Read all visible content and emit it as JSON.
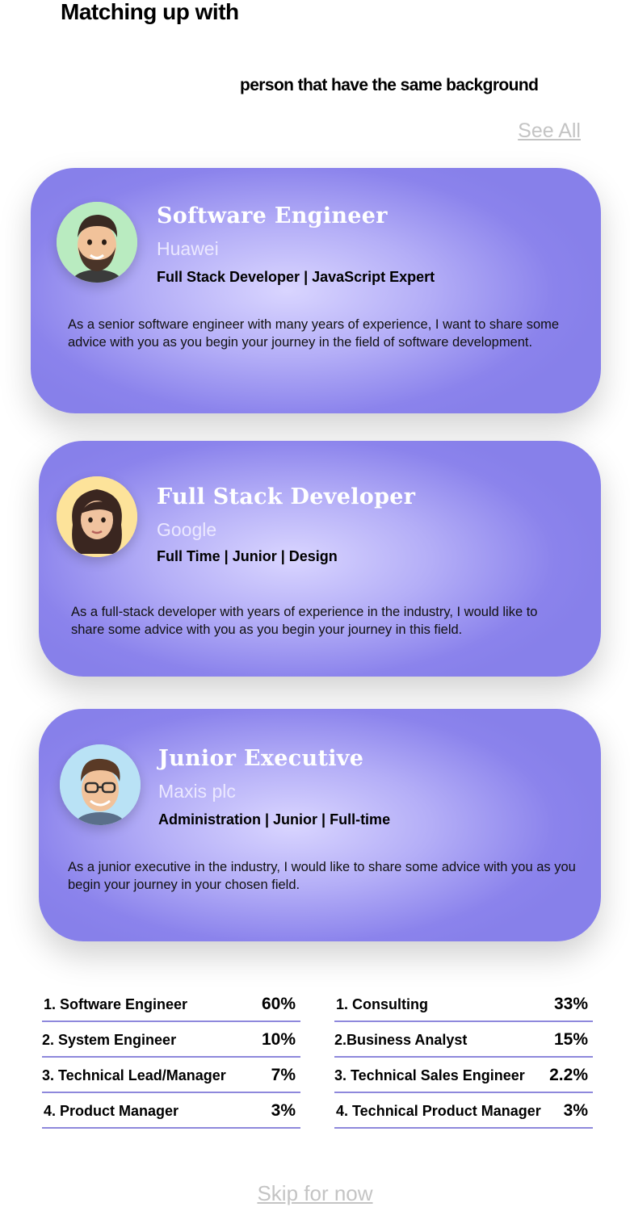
{
  "header": {
    "title": "Matching up with",
    "subtitle": "person that have the same background",
    "see_all": "See All"
  },
  "cards": [
    {
      "title": "Software Engineer",
      "company": "Huawei",
      "tags": "Full Stack Developer | JavaScript Expert",
      "description": "As a senior software engineer with many years of experience, I want to share some advice with you as you begin your journey in the field of software development.",
      "avatar_icon": "bearded-man-avatar-icon",
      "avatar_bg": "#b9ebc0"
    },
    {
      "title": "Full Stack Developer",
      "company": "Google",
      "tags": "Full Time | Junior | Design",
      "description": "As a full-stack developer with years of experience in the industry, I would like to share some advice with you as you begin your journey in this field.",
      "avatar_icon": "woman-avatar-icon",
      "avatar_bg": "#fde39a"
    },
    {
      "title": "Junior Executive",
      "company": "Maxis plc",
      "tags": "Administration | Junior | Full-time",
      "description": "As a junior executive in the industry, I would like to share some advice with you as you begin your journey in your chosen field.",
      "avatar_icon": "man-with-glasses-avatar-icon",
      "avatar_bg": "#b9e2f5"
    }
  ],
  "stats_left": [
    {
      "label": "1.  Software Engineer",
      "value": "60%"
    },
    {
      "label": "2. System Engineer",
      "value": "10%"
    },
    {
      "label": "3. Technical Lead/Manager",
      "value": "7%"
    },
    {
      "label": "4. Product Manager",
      "value": "3%"
    }
  ],
  "stats_right": [
    {
      "label": "1.  Consulting",
      "value": "33%"
    },
    {
      "label": "2.Business Analyst",
      "value": "15%"
    },
    {
      "label": "3. Technical Sales Engineer",
      "value": "2.2%"
    },
    {
      "label": "4. Technical Product Manager",
      "value": "3%"
    }
  ],
  "footer": {
    "skip": "Skip for now"
  },
  "colors": {
    "accent": "#8780ea",
    "divider": "#8e88dc",
    "link": "#c4c4c4"
  }
}
